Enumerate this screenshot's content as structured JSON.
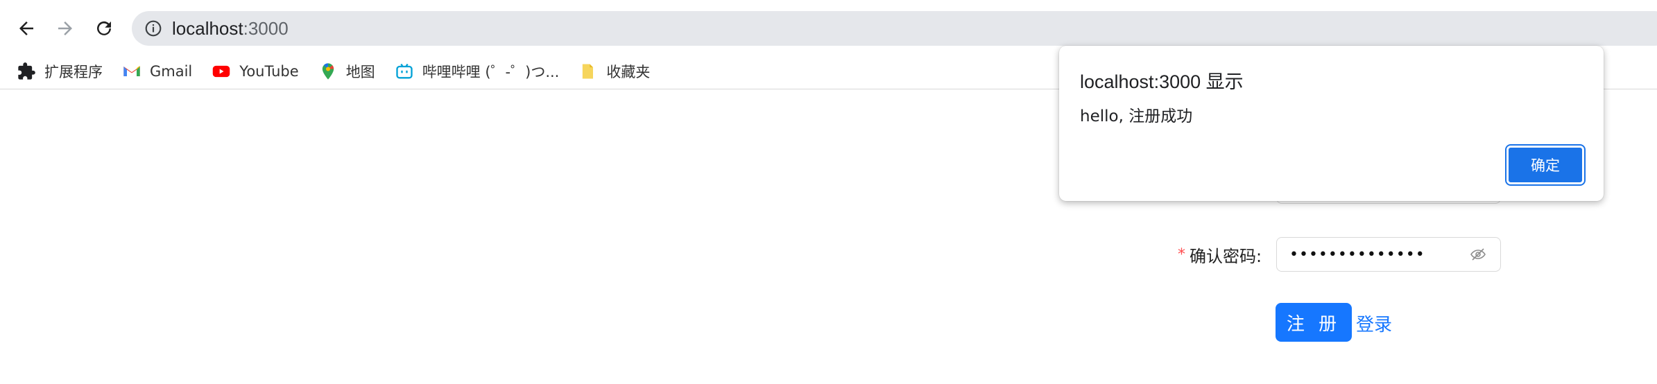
{
  "browser": {
    "url_host": "localhost",
    "url_port": ":3000",
    "nav": {
      "back_icon": "arrow-left",
      "forward_icon": "arrow-right",
      "reload_icon": "reload"
    },
    "info_icon": "info-circle"
  },
  "bookmarks": [
    {
      "label": "扩展程序",
      "icon": "puzzle-icon"
    },
    {
      "label": "Gmail",
      "icon": "gmail-icon"
    },
    {
      "label": "YouTube",
      "icon": "youtube-icon"
    },
    {
      "label": "地图",
      "icon": "maps-pin-icon"
    },
    {
      "label": "哔哩哔哩 (゜-゜)つ...",
      "icon": "bilibili-icon"
    },
    {
      "label": "收藏夹",
      "icon": "folder-icon"
    }
  ],
  "form": {
    "confirm_password": {
      "required_mark": "*",
      "label": "确认密码:",
      "value": "••••••••••••••",
      "toggle_icon": "eye-off"
    },
    "register_button": "注 册",
    "login_link": "登录"
  },
  "dialog": {
    "title": "localhost:3000 显示",
    "message": "hello, 注册成功",
    "ok_button": "确定"
  },
  "colors": {
    "primary": "#1677ff",
    "dialog_button": "#1a73e8",
    "required": "#ff4d4f",
    "tab_strip": "#b9e6ee"
  }
}
